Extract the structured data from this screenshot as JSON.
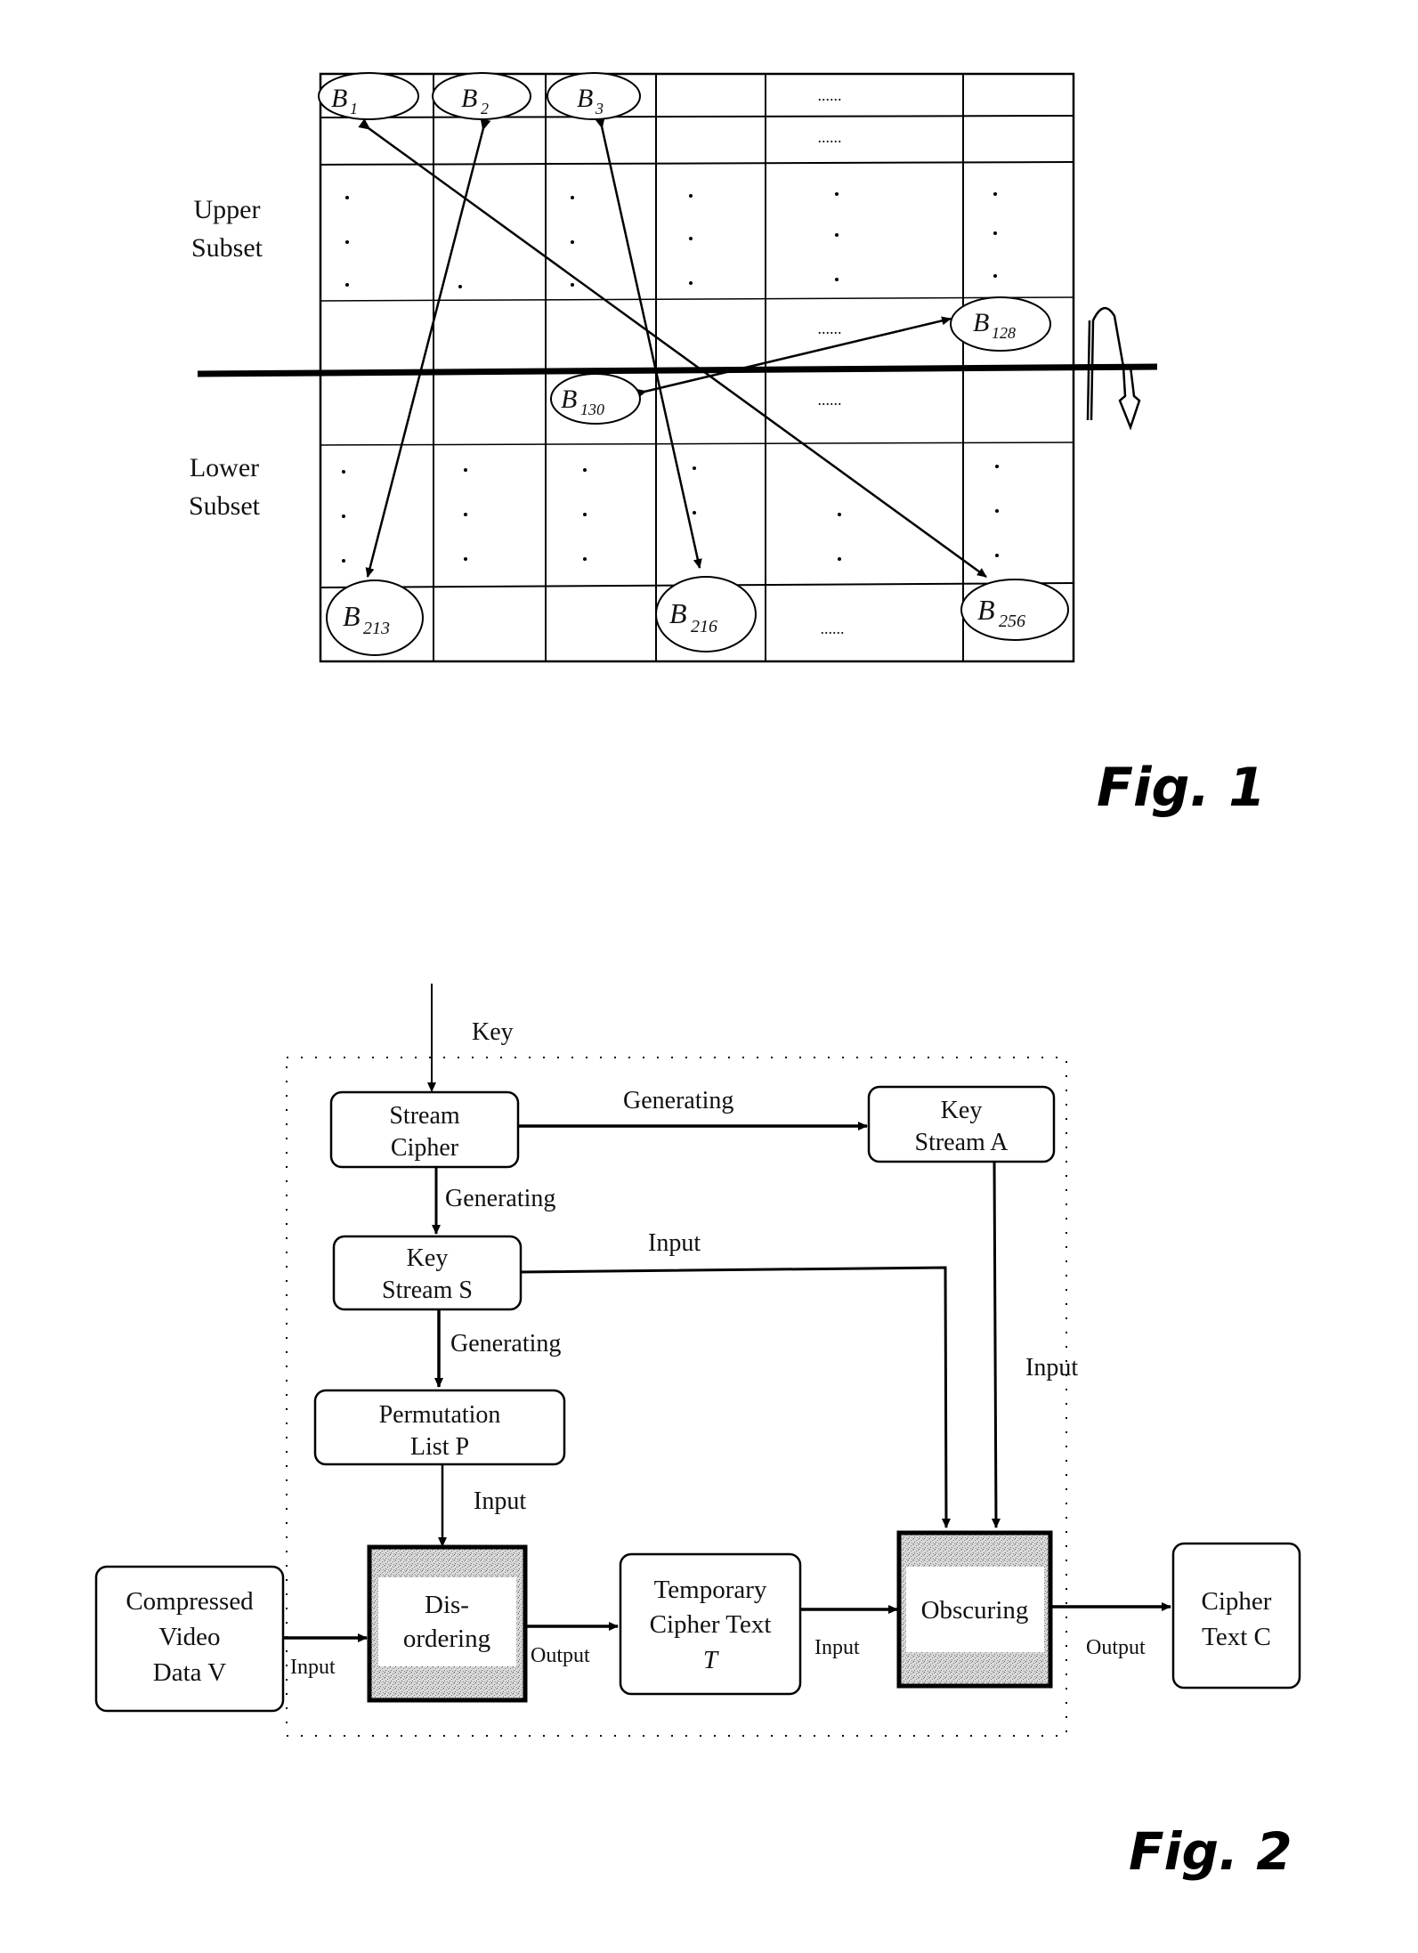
{
  "figure1": {
    "figure_label": "Fig. 1",
    "upper_label": [
      "Upper",
      "Subset"
    ],
    "lower_label": [
      "Lower",
      "Subset"
    ],
    "ellipsis": "......",
    "blocks": {
      "b1": {
        "base": "B",
        "sub": "1"
      },
      "b2": {
        "base": "B",
        "sub": "2"
      },
      "b3": {
        "base": "B",
        "sub": "3"
      },
      "b128": {
        "base": "B",
        "sub": "128"
      },
      "b130": {
        "base": "B",
        "sub": "130"
      },
      "b213": {
        "base": "B",
        "sub": "213"
      },
      "b216": {
        "base": "B",
        "sub": "216"
      },
      "b256": {
        "base": "B",
        "sub": "256"
      }
    },
    "swaps": [
      [
        "B1",
        "B256"
      ],
      [
        "B2",
        "B213"
      ],
      [
        "B3",
        "B216"
      ],
      [
        "B128",
        "B130"
      ]
    ],
    "mirror_axis": "horizontal",
    "rotation_indicator": "flip-around-axis"
  },
  "figure2": {
    "figure_label": "Fig. 2",
    "key_label": "Key",
    "nodes": {
      "stream_cipher": [
        "Stream",
        "Cipher"
      ],
      "key_stream_a": [
        "Key",
        "Stream A"
      ],
      "key_stream_s": [
        "Key",
        "Stream S"
      ],
      "permutation_list": [
        "Permutation",
        "List P"
      ],
      "compressed_video": [
        "Compressed",
        "Video",
        "Data V"
      ],
      "disordering": [
        "Dis-",
        "ordering"
      ],
      "temporary_cipher": [
        "Temporary",
        "Cipher Text",
        "T"
      ],
      "obscuring": [
        "Obscuring"
      ],
      "cipher_text": [
        "Cipher",
        "Text C"
      ]
    },
    "edge_labels": {
      "sc_to_ksa": "Generating",
      "sc_to_kss": "Generating",
      "kss_to_obs": "Input",
      "kss_to_perm": "Generating",
      "ksa_to_obs": "Input",
      "perm_to_dis": "Input",
      "video_to_dis": "Input",
      "dis_to_temp": "Output",
      "temp_to_obs": "Input",
      "obs_to_cipher": "Output"
    }
  }
}
